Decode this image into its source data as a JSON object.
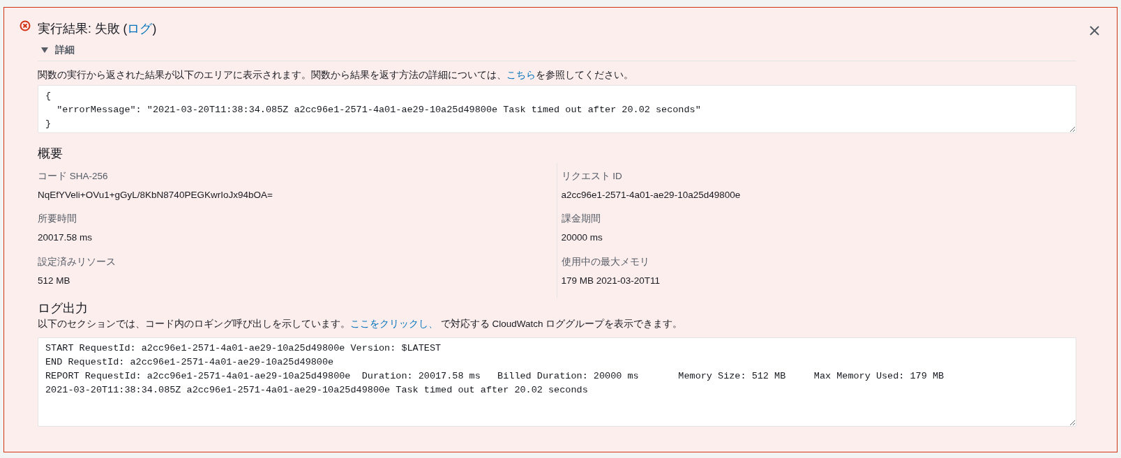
{
  "alert": {
    "kind": "error",
    "title": "実行結果: 失敗 (",
    "title_link": "ログ",
    "title_end": ")"
  },
  "details": {
    "label": "詳細",
    "expanded": true,
    "description": "関数の実行から返された結果が以下のエリアに表示されます。関数から結果を返す方法の詳細については、",
    "description_link": "こちら",
    "description_end": "を参照してください。",
    "result_lines": [
      "{",
      "  \"errorMessage\": \"2021-03-20T11:38:34.085Z a2cc96e1-2571-4a01-ae29-10a25d49800e Task timed out after 20.02 seconds\"",
      "}"
    ]
  },
  "summary": {
    "heading": "概要",
    "fields": [
      {
        "label": "コード SHA-256",
        "value": "NqEfYVeli+OVu1+gGyL/8KbN8740PEGKwrIoJx94bOA="
      },
      {
        "label": "リクエスト ID",
        "value": "a2cc96e1-2571-4a01-ae29-10a25d49800e"
      },
      {
        "label": "所要時間",
        "value": "20017.58 ms"
      },
      {
        "label": "課金期間",
        "value": "20000 ms"
      },
      {
        "label": "設定済みリソース",
        "value": "512 MB"
      },
      {
        "label": "使用中の最大メモリ",
        "value": "179 MB 2021-03-20T11"
      }
    ]
  },
  "log_output": {
    "heading": "ログ出力",
    "description": "以下のセクションでは、コード内のロギング呼び出しを示しています。",
    "description_link": "ここをクリックし、",
    "description_end": " で対応する CloudWatch ロググループを表示できます。",
    "lines": [
      "START RequestId: a2cc96e1-2571-4a01-ae29-10a25d49800e Version: $LATEST",
      "END RequestId: a2cc96e1-2571-4a01-ae29-10a25d49800e",
      "REPORT RequestId: a2cc96e1-2571-4a01-ae29-10a25d49800e  Duration: 20017.58 ms   Billed Duration: 20000 ms       Memory Size: 512 MB     Max Memory Used: 179 MB",
      "2021-03-20T11:38:34.085Z a2cc96e1-2571-4a01-ae29-10a25d49800e Task timed out after 20.02 seconds"
    ]
  }
}
